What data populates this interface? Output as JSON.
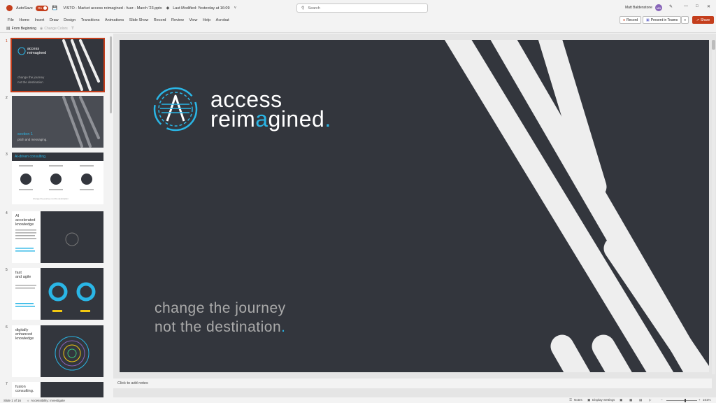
{
  "titlebar": {
    "autosave_label": "AutoSave",
    "autosave_state": "On",
    "doc_title": "VISTO - Market access reimagined - fuzz - March '23.pptx",
    "last_modified": "Last Modified: Yesterday at 16:09",
    "search_placeholder": "Search",
    "user_name": "Matt Baldenstone",
    "avatar_initials": "MB"
  },
  "menu": {
    "items": [
      "File",
      "Home",
      "Insert",
      "Draw",
      "Design",
      "Transitions",
      "Animations",
      "Slide Show",
      "Record",
      "Review",
      "View",
      "Help",
      "Acrobat"
    ],
    "record_label": "Record",
    "present_label": "Present in Teams",
    "share_label": "Share"
  },
  "toolbar": {
    "from_beginning": "From Beginning",
    "change_colors": "Change Colors"
  },
  "thumbnails": [
    {
      "num": "1",
      "active": true,
      "line1": "access",
      "line2": "reimagined",
      "tag1": "change the journey",
      "tag2": "not the destination"
    },
    {
      "num": "2",
      "active": false,
      "title": "section 1",
      "subtitle": "pitch and messaging."
    },
    {
      "num": "3",
      "active": false,
      "title": "AI-driven consulting.",
      "footer": "change the journey not the destination"
    },
    {
      "num": "4",
      "active": false,
      "title1": "AI",
      "title2": "accelerated",
      "title3": "knowledge"
    },
    {
      "num": "5",
      "active": false,
      "title1": "fast",
      "title2": "and agile"
    },
    {
      "num": "6",
      "active": false,
      "title1": "digitally",
      "title2": "enhanced",
      "title3": "knowledge"
    },
    {
      "num": "7",
      "active": false,
      "title1": "fusion",
      "title2": "consulting."
    }
  ],
  "slide": {
    "logo_line1": "access",
    "logo_line2_a": "reim",
    "logo_line2_b": "a",
    "logo_line2_c": "gined",
    "logo_dot": ".",
    "tagline1": "change the journey",
    "tagline2": "not the destination",
    "tagline_dot": ".",
    "colors": {
      "background": "#33363d",
      "accent": "#2ab6e6",
      "stripes": "#eeeeee"
    }
  },
  "notes": {
    "placeholder": "Click to add notes"
  },
  "status": {
    "slide_counter": "Slide 1 of 16",
    "accessibility": "Accessibility: Investigate",
    "notes_label": "Notes",
    "display_settings": "Display Settings",
    "zoom": "161%"
  }
}
